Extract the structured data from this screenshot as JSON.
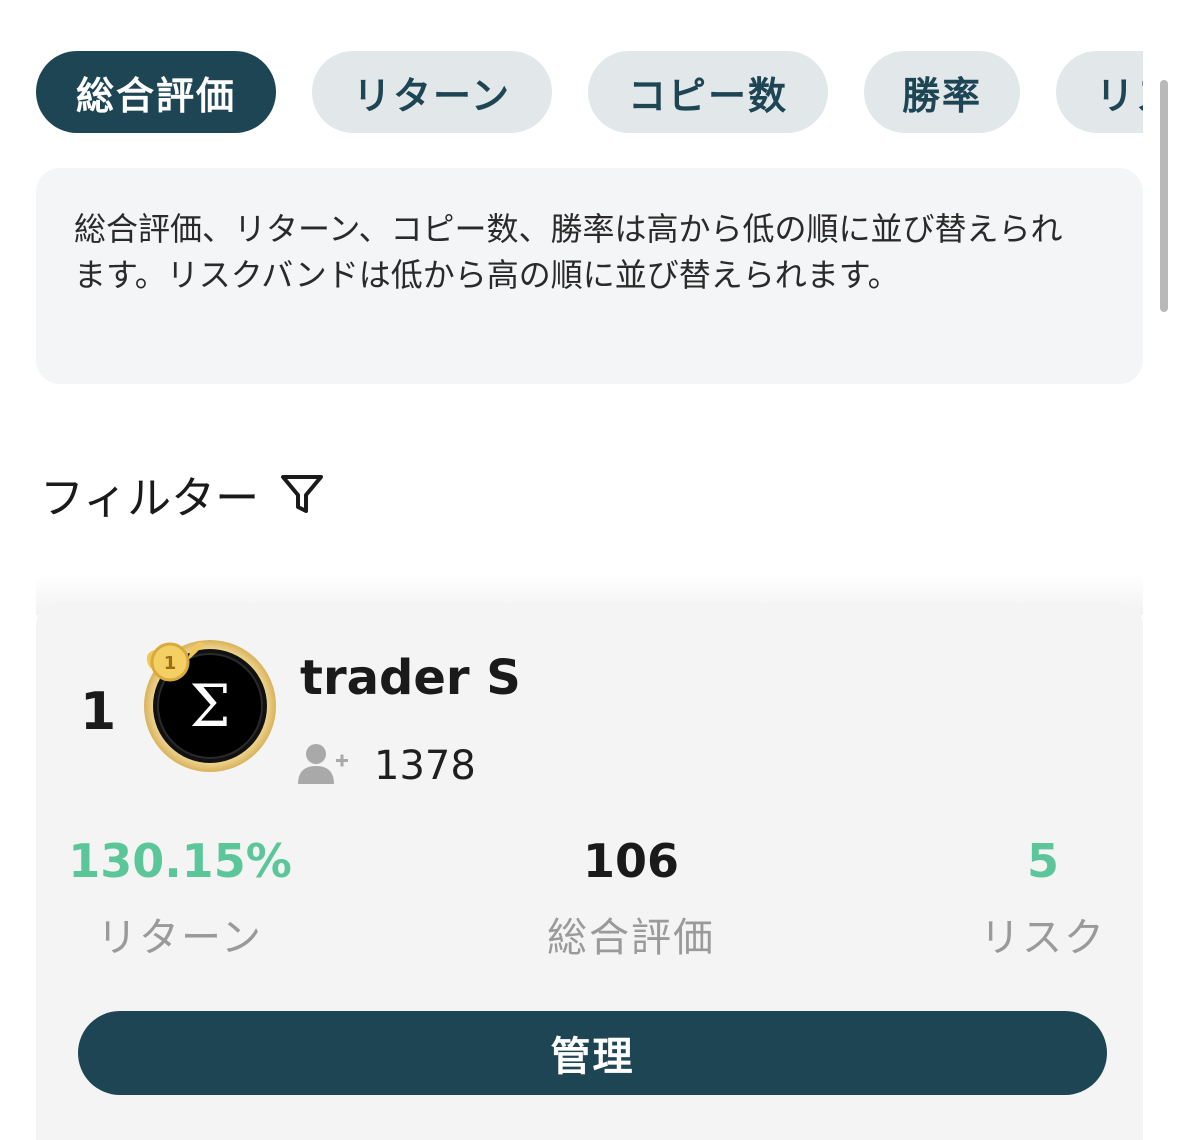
{
  "tabs": [
    {
      "label": "総合評価",
      "active": true
    },
    {
      "label": "リターン",
      "active": false
    },
    {
      "label": "コピー数",
      "active": false
    },
    {
      "label": "勝率",
      "active": false
    },
    {
      "label": "リス",
      "active": false
    }
  ],
  "info": {
    "text": "総合評価、リターン、コピー数、勝率は高から低の順に並び替えられます。リスクバンドは低から高の順に並び替えられます。"
  },
  "filter": {
    "label": "フィルター",
    "icon": "funnel-icon"
  },
  "trader_card": {
    "rank": "1",
    "avatar_glyph": "Σ",
    "badge_number": "1",
    "name": "trader S",
    "copy_icon": "user-plus-icon",
    "copy_count": "1378",
    "stats": [
      {
        "value": "130.15%",
        "label": "リターン",
        "color": "#5cc69b"
      },
      {
        "value": "106",
        "label": "総合評価",
        "color": "#1a1a1a"
      },
      {
        "value": "5",
        "label": "リスク",
        "color": "#5cc69b"
      }
    ],
    "manage_label": "管理"
  },
  "colors": {
    "primary": "#1e4553",
    "tab_inactive": "#e2e8ea",
    "positive": "#5cc69b",
    "muted_label": "#9a9a9a"
  }
}
